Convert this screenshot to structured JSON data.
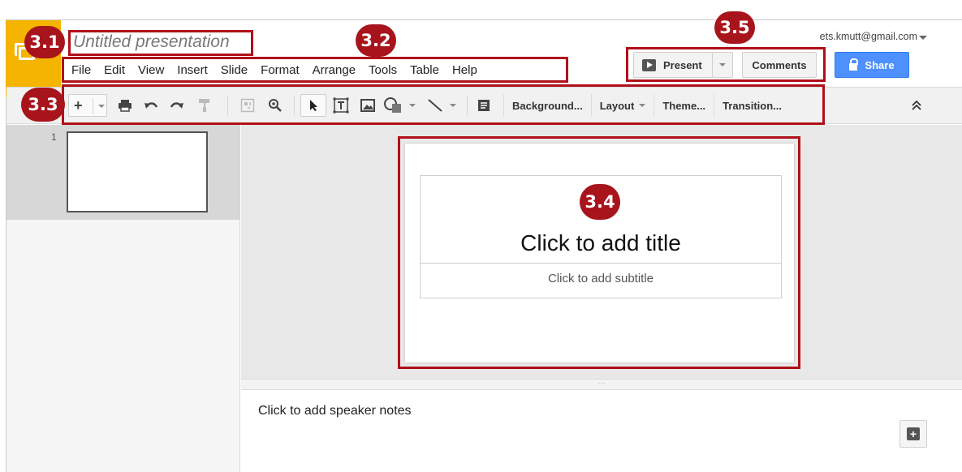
{
  "app": {
    "title": "Untitled presentation",
    "user_email": "ets.kmutt@gmail.com"
  },
  "menu": {
    "items": [
      "File",
      "Edit",
      "View",
      "Insert",
      "Slide",
      "Format",
      "Arrange",
      "Tools",
      "Table",
      "Help"
    ]
  },
  "header_buttons": {
    "present": "Present",
    "comments": "Comments",
    "share": "Share"
  },
  "toolbar": {
    "background": "Background...",
    "layout": "Layout",
    "theme": "Theme...",
    "transition": "Transition..."
  },
  "filmstrip": {
    "slide_number": "1"
  },
  "slide": {
    "title_placeholder": "Click to add title",
    "subtitle_placeholder": "Click to add subtitle"
  },
  "notes": {
    "placeholder": "Click to add speaker notes"
  },
  "annotations": {
    "a31": "3.1",
    "a32": "3.2",
    "a33": "3.3",
    "a34": "3.4",
    "a35": "3.5"
  },
  "colors": {
    "accent_logo": "#f4b400",
    "share_blue": "#4d90fe",
    "annotation_red": "#b0101a"
  },
  "icons": {
    "logo": "slides-logo-icon",
    "present": "play-icon",
    "share": "lock-icon",
    "collapse": "double-chevron-up-icon",
    "add_note": "add-comment-icon"
  }
}
